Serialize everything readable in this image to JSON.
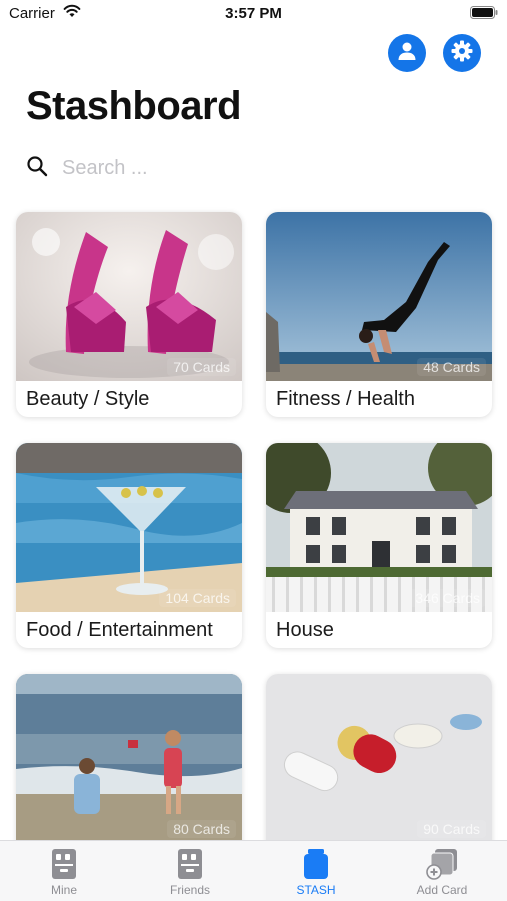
{
  "status_bar": {
    "carrier": "Carrier",
    "time": "3:57 PM"
  },
  "header": {
    "title": "Stashboard"
  },
  "search": {
    "placeholder": "Search ..."
  },
  "colors": {
    "accent": "#1475e8",
    "tab_active": "#1a7cf5",
    "tab_inactive": "#8e8e93"
  },
  "cards": [
    {
      "label": "Beauty / Style",
      "count": "70 Cards"
    },
    {
      "label": "Fitness / Health",
      "count": "48 Cards"
    },
    {
      "label": "Food / Entertainment",
      "count": "104 Cards"
    },
    {
      "label": "House",
      "count": "346 Cards"
    },
    {
      "label": "",
      "count": "80 Cards"
    },
    {
      "label": "",
      "count": "90 Cards"
    }
  ],
  "tabs": [
    {
      "label": "Mine",
      "icon": "archive-box-icon"
    },
    {
      "label": "Friends",
      "icon": "archive-box-icon"
    },
    {
      "label": "STASH",
      "icon": "jar-icon",
      "active": true
    },
    {
      "label": "Add Card",
      "icon": "add-card-icon"
    }
  ]
}
